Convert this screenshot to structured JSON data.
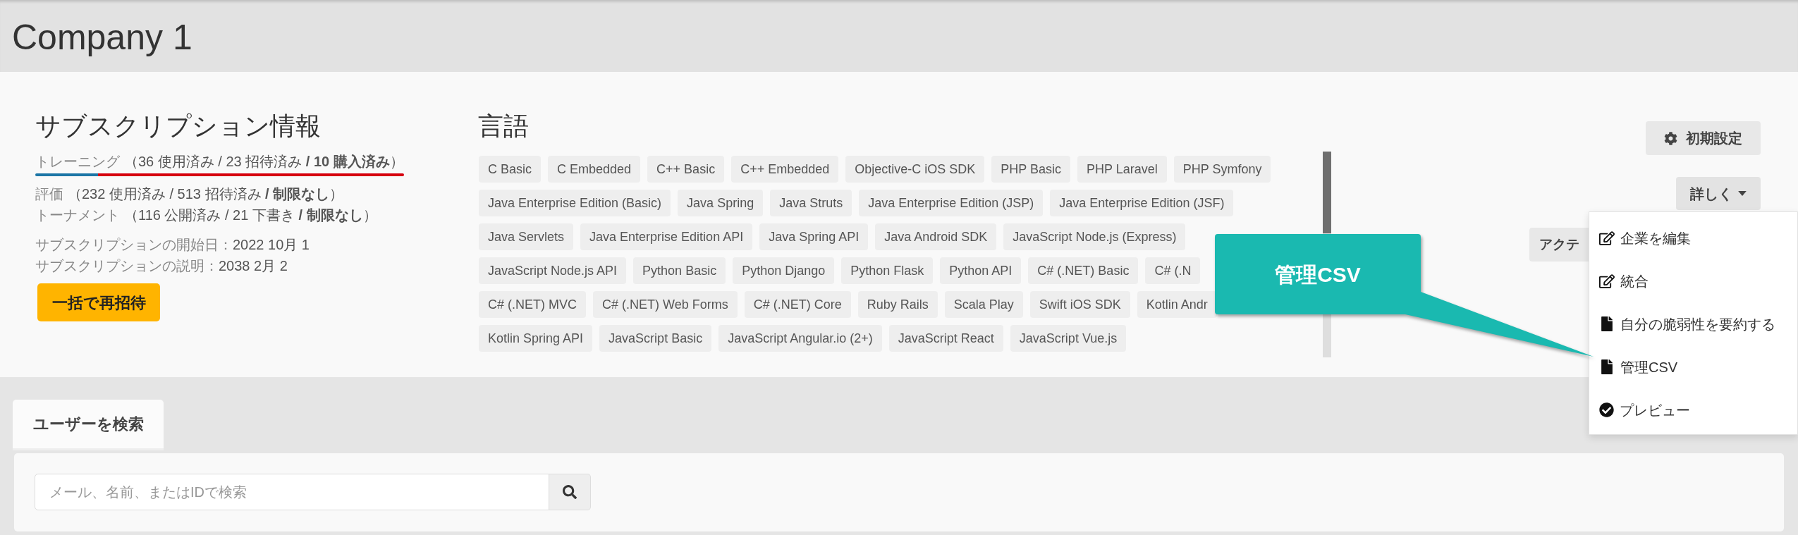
{
  "header": {
    "title": "Company 1"
  },
  "subscription": {
    "heading": "サブスクリプション情報",
    "usage": [
      {
        "label": "トレーニング",
        "detail": "（36 使用済み / 23 招待済み **/ 10 購入済み**）",
        "highlighted": true
      },
      {
        "label": "評価",
        "detail": "（232 使用済み / 513 招待済み **/ 制限なし**）",
        "highlighted": false
      },
      {
        "label": "トーナメント",
        "detail": "（116 公開済み / 21 下書き **/ 制限なし**）",
        "highlighted": false
      }
    ],
    "dates": [
      {
        "label": "サブスクリプションの開始日：",
        "value": "2022 10月 1"
      },
      {
        "label": "サブスクリプションの説明：",
        "value": "2038 2月 2"
      }
    ],
    "reinvite_button": "一括で再招待"
  },
  "languages": {
    "heading": "言語",
    "tag_rows": [
      [
        "C Basic",
        "C Embedded",
        "C++ Basic",
        "C++ Embedded",
        "Objective-C iOS SDK",
        "PHP Basic",
        "PHP Laravel",
        "PHP Symfony"
      ],
      [
        "Java Enterprise Edition (Basic)",
        "Java Spring",
        "Java Struts",
        "Java Enterprise Edition (JSP)",
        "Java Enterprise Edition (JSF)"
      ],
      [
        "Java Servlets",
        "Java Enterprise Edition API",
        "Java Spring API",
        "Java Android SDK",
        "JavaScript Node.js (Express)"
      ],
      [
        "JavaScript Node.js API",
        "Python Basic",
        "Python Django",
        "Python Flask",
        "Python API",
        "C# (.NET) Basic",
        "C# (.N"
      ],
      [
        "C# (.NET) MVC",
        "C# (.NET) Web Forms",
        "C# (.NET) Core",
        "Ruby Rails",
        "Scala Play",
        "Swift iOS SDK",
        "Kotlin Andr"
      ],
      [
        "Kotlin Spring API",
        "JavaScript Basic",
        "JavaScript Angular.io (2+)",
        "JavaScript React",
        "JavaScript Vue.js"
      ]
    ]
  },
  "actions": {
    "settings_button": {
      "label": "初期設定"
    },
    "more_button": {
      "label": "詳しく",
      "expanded": true
    },
    "partial_button": {
      "label": "アクテ"
    },
    "menu": [
      {
        "kind": "edit",
        "label": "企業を編集"
      },
      {
        "kind": "edit",
        "label": "統合"
      },
      {
        "kind": "file",
        "label": "自分の脆弱性を要約する"
      },
      {
        "kind": "file",
        "label": "管理CSV"
      },
      {
        "kind": "check",
        "label": "プレビュー"
      }
    ]
  },
  "callout": {
    "text": "管理CSV"
  },
  "user_search": {
    "tabs": [
      {
        "label": "ユーザーを検索",
        "selected": true
      }
    ],
    "placeholder": "メール、名前、またはIDで検索"
  }
}
